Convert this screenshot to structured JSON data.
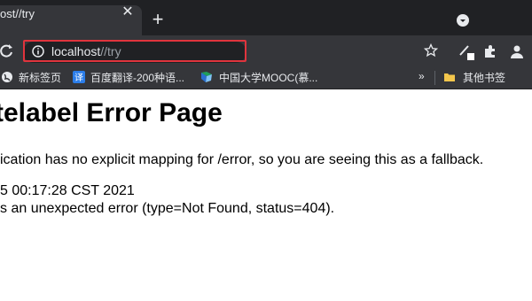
{
  "tab": {
    "title": "ost//try",
    "close_glyph": "✕",
    "new_tab_glyph": "+"
  },
  "address_bar": {
    "host": "localhost",
    "path": "//try"
  },
  "bookmarks": [
    {
      "label": "新标签页",
      "icon": "globe-icon"
    },
    {
      "label": "百度翻译-200种语...",
      "icon": "translate-icon"
    },
    {
      "label": "中国大学MOOC(慕...",
      "icon": "mooc-icon"
    }
  ],
  "bookmarks_overflow": "»",
  "other_bookmarks": {
    "label": "其他书签",
    "icon": "folder-icon"
  },
  "page": {
    "title": "telabel Error Page",
    "lines": [
      "ication has no explicit mapping for /error, so you are seeing this as a fallback.",
      " 5 00:17:28 CST 2021",
      "s an unexpected error (type=Not Found, status=404)."
    ]
  },
  "colors": {
    "chrome_dark": "#202124",
    "chrome_toolbar": "#35363a",
    "highlight": "#e0343d",
    "folder": "#f3c64c"
  }
}
